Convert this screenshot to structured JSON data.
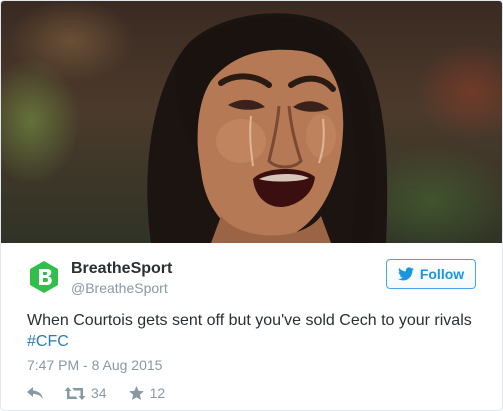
{
  "tweet": {
    "author_name": "BreatheSport",
    "author_handle": "@BreatheSport",
    "text": "When Courtois gets sent off but you've sold Cech to your rivals",
    "hashtag": "#CFC",
    "timestamp": "7:47 PM - 8 Aug 2015"
  },
  "follow": {
    "label": "Follow"
  },
  "actions": {
    "retweet_count": "34",
    "like_count": "12"
  },
  "colors": {
    "brand_green": "#2fbf4a",
    "link_blue": "#2b7bb9",
    "follow_blue": "#1b95e0",
    "muted_gray": "#8899a6"
  },
  "icons": {
    "logo": "breathesport-logo-icon",
    "follow": "twitter-bird-icon",
    "reply": "reply-icon",
    "retweet": "retweet-icon",
    "like": "star-icon"
  }
}
